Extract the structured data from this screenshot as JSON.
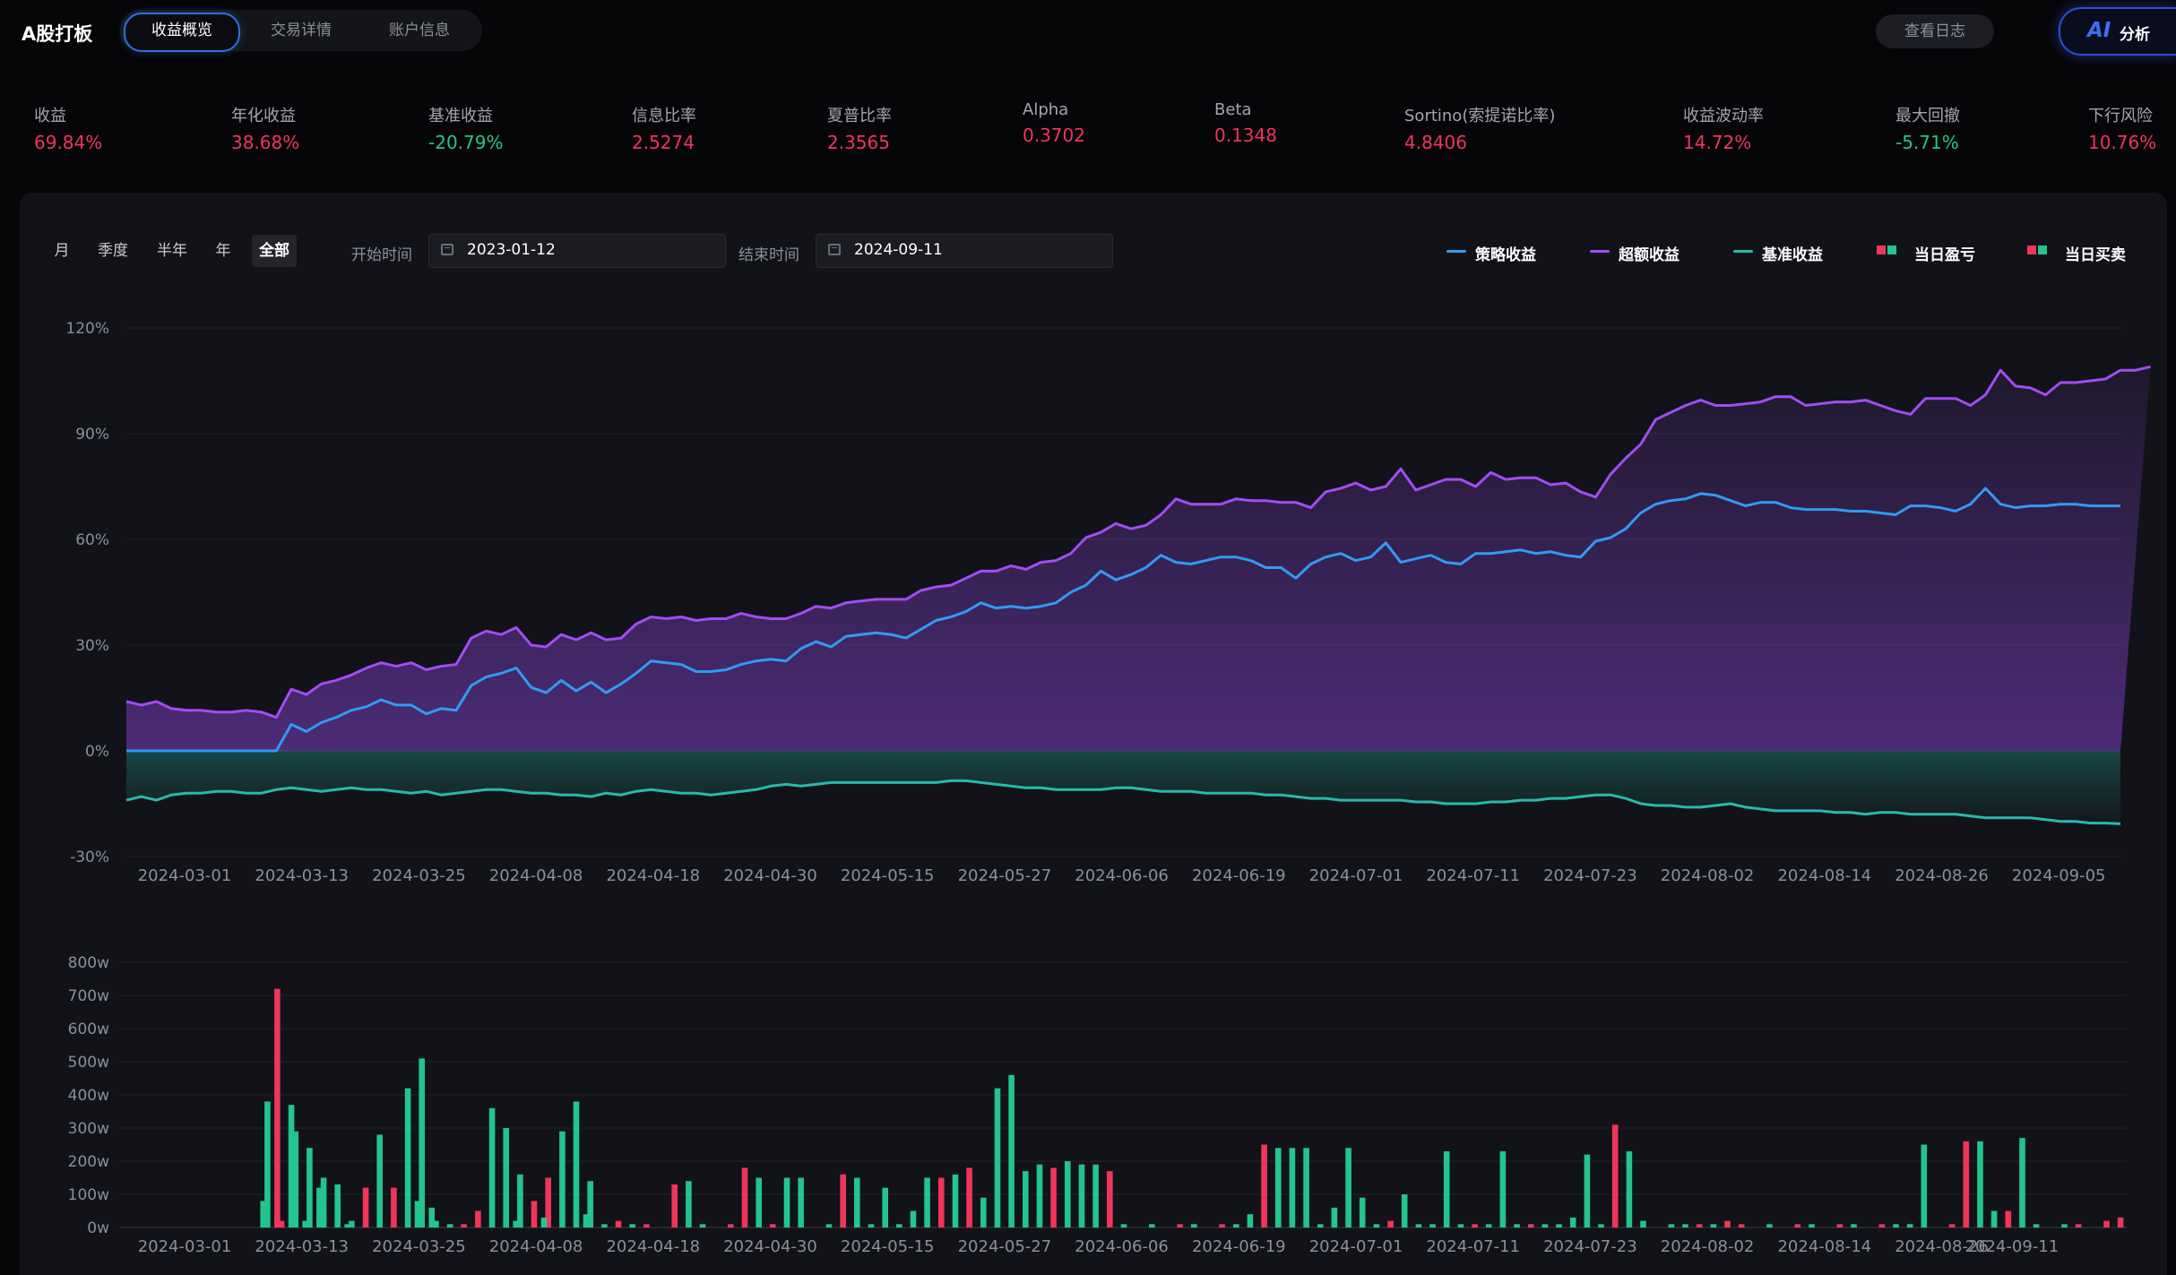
{
  "app": {
    "title": "A股打板"
  },
  "nav": {
    "tabs": [
      "收益概览",
      "交易详情",
      "账户信息"
    ]
  },
  "header": {
    "log_label": "查看日志",
    "ai_mark": "AI",
    "ai_label": "分析"
  },
  "colors": {
    "up": "#f0355a",
    "down": "#23c48e",
    "strategy": "#2e9bf5",
    "excess": "#a24cf5",
    "benchmark": "#28b9ad",
    "accent": "#2f6fe0"
  },
  "metrics": [
    {
      "label": "收益",
      "value": "69.84%",
      "tone": "up"
    },
    {
      "label": "年化收益",
      "value": "38.68%",
      "tone": "up"
    },
    {
      "label": "基准收益",
      "value": "-20.79%",
      "tone": "down"
    },
    {
      "label": "信息比率",
      "value": "2.5274",
      "tone": "up"
    },
    {
      "label": "夏普比率",
      "value": "2.3565",
      "tone": "up"
    },
    {
      "label": "Alpha",
      "value": "0.3702",
      "tone": "up"
    },
    {
      "label": "Beta",
      "value": "0.1348",
      "tone": "up"
    },
    {
      "label": "Sortino(索提诺比率)",
      "value": "4.8406",
      "tone": "up"
    },
    {
      "label": "收益波动率",
      "value": "14.72%",
      "tone": "up"
    },
    {
      "label": "最大回撤",
      "value": "-5.71%",
      "tone": "down"
    },
    {
      "label": "下行风险",
      "value": "10.76%",
      "tone": "up"
    }
  ],
  "filters": {
    "periods": [
      "月",
      "季度",
      "半年",
      "年",
      "全部"
    ],
    "active_period": "全部",
    "start_label": "开始时间",
    "start_value": "2023-01-12",
    "end_label": "结束时间",
    "end_value": "2024-09-11"
  },
  "legend": [
    {
      "label": "策略收益",
      "kind": "line",
      "color": "#2e9bf5"
    },
    {
      "label": "超额收益",
      "kind": "line",
      "color": "#a24cf5"
    },
    {
      "label": "基准收益",
      "kind": "line",
      "color": "#28b9ad"
    },
    {
      "label": "当日盈亏",
      "kind": "bar"
    },
    {
      "label": "当日买卖",
      "kind": "bar"
    }
  ],
  "chart_data": [
    {
      "type": "area",
      "x_ticks": [
        "2024-03-01",
        "2024-03-13",
        "2024-03-25",
        "2024-04-08",
        "2024-04-18",
        "2024-04-30",
        "2024-05-15",
        "2024-05-27",
        "2024-06-06",
        "2024-06-19",
        "2024-07-01",
        "2024-07-11",
        "2024-07-23",
        "2024-08-02",
        "2024-08-14",
        "2024-08-26",
        "2024-09-05"
      ],
      "y_ticks": [
        "120%",
        "90%",
        "60%",
        "30%",
        "0%",
        "-30%"
      ],
      "ylim": [
        -30,
        120
      ],
      "grid": true,
      "legend_position": "top-right",
      "series": [
        {
          "name": "策略收益",
          "color": "#2e9bf5",
          "values": [
            0,
            0,
            0,
            0,
            0,
            0,
            0,
            0,
            0,
            0,
            0,
            7.5,
            5.5,
            8,
            9.5,
            11.5,
            12.5,
            14.5,
            13,
            13,
            10.5,
            12,
            11.5,
            18.5,
            21,
            22,
            23.5,
            18,
            16.5,
            20,
            17,
            19.5,
            16.5,
            19,
            22,
            25.5,
            25,
            24.5,
            22.5,
            22.5,
            23,
            24.5,
            25.5,
            26,
            25.5,
            29,
            31,
            29.5,
            32.5,
            33,
            33.5,
            33,
            32,
            34.5,
            37,
            38,
            39.5,
            42,
            40.5,
            41,
            40.5,
            41,
            42,
            45,
            47,
            51,
            48.5,
            50,
            52,
            55.5,
            53.5,
            53,
            54,
            55,
            55,
            54,
            52,
            52,
            49,
            53,
            55,
            56,
            54,
            55,
            59,
            53.5,
            54.5,
            55.5,
            53.5,
            53,
            56,
            56,
            56.5,
            57,
            56,
            56.5,
            55.5,
            55,
            59.5,
            60.5,
            63,
            67.5,
            70,
            71,
            71.5,
            73,
            72.5,
            71,
            69.5,
            70.5,
            70.5,
            69,
            68.5,
            68.5,
            68.5,
            68,
            68,
            67.5,
            67,
            69.5,
            69.5,
            69,
            68,
            70,
            74.5,
            70,
            69,
            69.5,
            69.5,
            70,
            70,
            69.5,
            69.5,
            69.5
          ]
        },
        {
          "name": "超额收益",
          "color": "#a24cf5",
          "values": [
            14,
            13,
            14,
            12,
            11.5,
            11.5,
            11,
            11,
            11.5,
            11,
            9.5,
            17.5,
            16,
            19,
            20,
            21.5,
            23.5,
            25,
            24,
            25,
            23,
            24,
            24.5,
            32,
            34,
            33,
            35,
            30,
            29.5,
            33,
            31.5,
            33.5,
            31.5,
            32,
            36,
            38,
            37.5,
            38,
            37,
            37.5,
            37.5,
            39,
            38,
            37.5,
            37.5,
            39,
            41,
            40.5,
            42,
            42.5,
            43,
            43,
            43,
            45.5,
            46.5,
            47,
            49,
            51,
            51,
            52.5,
            51.5,
            53.5,
            54,
            56,
            60.5,
            62,
            64.5,
            63,
            64,
            67,
            71.5,
            70,
            70,
            70,
            71.5,
            71,
            71,
            70.5,
            70.5,
            69,
            73.5,
            74.5,
            76,
            74,
            75,
            80,
            74,
            75.5,
            77,
            77,
            75,
            79,
            77,
            77.5,
            77.5,
            75.5,
            76,
            73.5,
            72,
            78.5,
            83,
            87,
            94,
            96,
            98,
            99.5,
            98,
            98,
            98.5,
            99,
            100.5,
            100.5,
            98,
            98.5,
            99,
            99,
            99.5,
            98,
            96.5,
            95.5,
            100,
            100,
            100,
            98,
            101,
            108,
            103.5,
            103,
            101,
            104.5,
            104.5,
            105,
            105.5,
            108,
            108,
            109
          ]
        },
        {
          "name": "基准收益",
          "color": "#28b9ad",
          "values": [
            -14,
            -13,
            -14,
            -12.5,
            -12,
            -12,
            -11.5,
            -11.5,
            -12,
            -12,
            -11,
            -10.5,
            -11,
            -11.5,
            -11,
            -10.5,
            -11,
            -11,
            -11.5,
            -12,
            -11.5,
            -12.5,
            -12,
            -11.5,
            -11,
            -11,
            -11.5,
            -12,
            -12,
            -12.5,
            -12.5,
            -13,
            -12,
            -12.5,
            -11.5,
            -11,
            -11.5,
            -12,
            -12,
            -12.5,
            -12,
            -11.5,
            -11,
            -10,
            -9.5,
            -10,
            -9.5,
            -9,
            -9,
            -9,
            -9,
            -9,
            -9,
            -9,
            -9,
            -8.5,
            -8.5,
            -9,
            -9.5,
            -10,
            -10.5,
            -10.5,
            -11,
            -11,
            -11,
            -11,
            -10.5,
            -10.5,
            -11,
            -11.5,
            -11.5,
            -11.5,
            -12,
            -12,
            -12,
            -12,
            -12.5,
            -12.5,
            -13,
            -13.5,
            -13.5,
            -14,
            -14,
            -14,
            -14,
            -14,
            -14.5,
            -14.5,
            -15,
            -15,
            -15,
            -14.5,
            -14.5,
            -14,
            -14,
            -13.5,
            -13.5,
            -13,
            -12.5,
            -12.5,
            -13.5,
            -15,
            -15.5,
            -15.5,
            -16,
            -16,
            -15.5,
            -15,
            -16,
            -16.5,
            -17,
            -17,
            -17,
            -17,
            -17.5,
            -17.5,
            -18,
            -17.5,
            -17.5,
            -18,
            -18,
            -18,
            -18,
            -18.5,
            -19,
            -19,
            -19,
            -19,
            -19.5,
            -20,
            -20,
            -20.5,
            -20.5,
            -20.7
          ]
        }
      ]
    },
    {
      "type": "bar",
      "x_ticks": [
        "2024-03-01",
        "2024-03-13",
        "2024-03-25",
        "2024-04-08",
        "2024-04-18",
        "2024-04-30",
        "2024-05-15",
        "2024-05-27",
        "2024-06-06",
        "2024-06-19",
        "2024-07-01",
        "2024-07-11",
        "2024-07-23",
        "2024-08-02",
        "2024-08-14",
        "2024-08-26",
        "2024-09-11"
      ],
      "y_ticks": [
        "800w",
        "700w",
        "600w",
        "500w",
        "400w",
        "300w",
        "200w",
        "100w",
        "0w"
      ],
      "ylim": [
        0,
        800
      ],
      "unit": "w",
      "grid": true,
      "series": [
        {
          "name": "当日盈亏",
          "color_up": "#f0355a",
          "color_down": "#23c48e",
          "values": [
            0,
            0,
            0,
            0,
            0,
            0,
            0,
            0,
            0,
            0,
            -380,
            20,
            -290,
            -240,
            -150,
            -130,
            -20,
            120,
            -280,
            120,
            -420,
            -510,
            -20,
            -10,
            10,
            50,
            -360,
            -300,
            -160,
            80,
            150,
            -290,
            -380,
            -140,
            -10,
            20,
            -10,
            10,
            0,
            130,
            -140,
            -10,
            0,
            10,
            180,
            -150,
            10,
            -150,
            -150,
            0,
            -10,
            160,
            -150,
            -10,
            -120,
            -10,
            -50,
            -150,
            150,
            -160,
            180,
            -90,
            -420,
            -460,
            -170,
            -190,
            180,
            -200,
            -190,
            -190,
            170,
            -10,
            0,
            -10,
            0,
            10,
            -10,
            0,
            10,
            -10,
            -40,
            250,
            -240,
            -240,
            -240,
            -10,
            -60,
            -240,
            -90,
            -10,
            20,
            -100,
            -10,
            -10,
            -230,
            -10,
            10,
            -10,
            -230,
            -10,
            10,
            -10,
            -10,
            -30,
            -220,
            -10,
            310,
            -230,
            -20,
            0,
            -10,
            -10,
            10,
            -10,
            20,
            10,
            0,
            -10,
            0,
            10,
            -10,
            0,
            10,
            -10,
            0,
            10,
            -10,
            -10,
            -250,
            0,
            10,
            260,
            -260,
            -50,
            50,
            -270,
            -10,
            0,
            -10,
            10,
            0,
            20,
            30
          ]
        },
        {
          "name": "当日买卖",
          "color_up": "#f0355a",
          "color_down": "#23c48e",
          "values": [
            0,
            0,
            0,
            0,
            0,
            0,
            0,
            0,
            0,
            0,
            -80,
            720,
            -370,
            -20,
            -120,
            0,
            -10,
            0,
            0,
            0,
            0,
            -80,
            -60,
            0,
            0,
            0,
            0,
            0,
            -20,
            0,
            -30,
            0,
            0,
            -40,
            0,
            0,
            0,
            0,
            0,
            0,
            0,
            0,
            0,
            0,
            0,
            0,
            0,
            0,
            0,
            0,
            0,
            0,
            0,
            0,
            0,
            0,
            0,
            0,
            0,
            0,
            0,
            0,
            0,
            0,
            0,
            0,
            0,
            0,
            0,
            0,
            0,
            0,
            0,
            0,
            0,
            0,
            0,
            0,
            0,
            0,
            0,
            0,
            0,
            0,
            0,
            0,
            0,
            0,
            0,
            0,
            0,
            0,
            0,
            0,
            0,
            0,
            0,
            0,
            0,
            0,
            0,
            0,
            0,
            0,
            0,
            0,
            0,
            0,
            0,
            0,
            0,
            0,
            0,
            0,
            0,
            0,
            0,
            0,
            0,
            0,
            0,
            0,
            0,
            0,
            0,
            0,
            0,
            0,
            0,
            0,
            0,
            0,
            0,
            0,
            0,
            0,
            0,
            0,
            0,
            0,
            0,
            0,
            0
          ]
        }
      ]
    }
  ]
}
